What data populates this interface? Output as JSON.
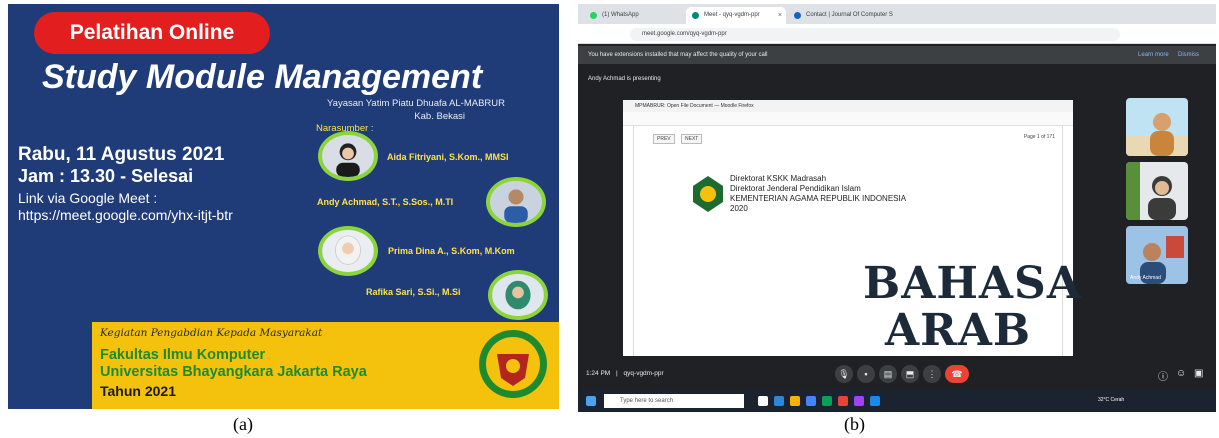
{
  "poster": {
    "badge": "Pelatihan Online",
    "title": "Study Module Management",
    "org_line1": "Yayasan Yatim Piatu Dhuafa AL-MABRUR",
    "org_line2": "Kab. Bekasi",
    "narasumber_label": "Narasumber :",
    "date": "Rabu, 11 Agustus 2021",
    "time": "Jam : 13.30 - Selesai",
    "link_label": "Link via Google Meet :",
    "link_url": "https://meet.google.com/yhx-itjt-btr",
    "speakers": [
      {
        "name": "Aida Fitriyani, S.Kom., MMSI"
      },
      {
        "name": "Andy Achmad, S.T., S.Sos., M.TI"
      },
      {
        "name": "Prima Dina A., S.Kom, M.Kom"
      },
      {
        "name": "Rafika Sari, S.Si., M.Si"
      }
    ],
    "footer": {
      "kegiatan": "Kegiatan Pengabdian Kepada Masyarakat",
      "fakultas": "Fakultas Ilmu Komputer",
      "universitas": "Universitas Bhayangkara Jakarta Raya",
      "tahun": "Tahun 2021"
    },
    "colors": {
      "background": "#1f3b78",
      "badge": "#e31e1e",
      "footer": "#f4c20d",
      "accent_green": "#1d8a2e"
    }
  },
  "captions": {
    "a": "(a)",
    "b": "(b)"
  },
  "meet": {
    "tabs": [
      {
        "label": "(1) WhatsApp"
      },
      {
        "label": "Meet - qyq-vgdm-ppr"
      },
      {
        "label": "Contact | Journal Of Computer S"
      }
    ],
    "url": "meet.google.com/qyq-vgdm-ppr",
    "extension_notice": "You have extensions installed that may affect the quality of your call",
    "learn_more": "Learn more",
    "dismiss": "Dismiss",
    "presenting": "Andy Achmad is presenting",
    "shared_window": {
      "title": "MPMABRUR: Open File Document — Moodle Firefox",
      "prev": "PREV",
      "next": "NEXT",
      "page": "Page 1 of 171",
      "doc_lines": [
        "Direktorat KSKK Madrasah",
        "Direktorat Jenderal Pendidikan Islam",
        "KEMENTERIAN AGAMA REPUBLIK INDONESIA",
        "2020"
      ],
      "cover_line1": "BAHASA",
      "cover_line2": "ARAB"
    },
    "participant_label": "Andy Achmad",
    "meeting_time": "1:24 PM",
    "meeting_code": "qyq-vgdm-ppr",
    "taskbar_search": "Type here to search",
    "tray_text": "32°C Cerah"
  }
}
